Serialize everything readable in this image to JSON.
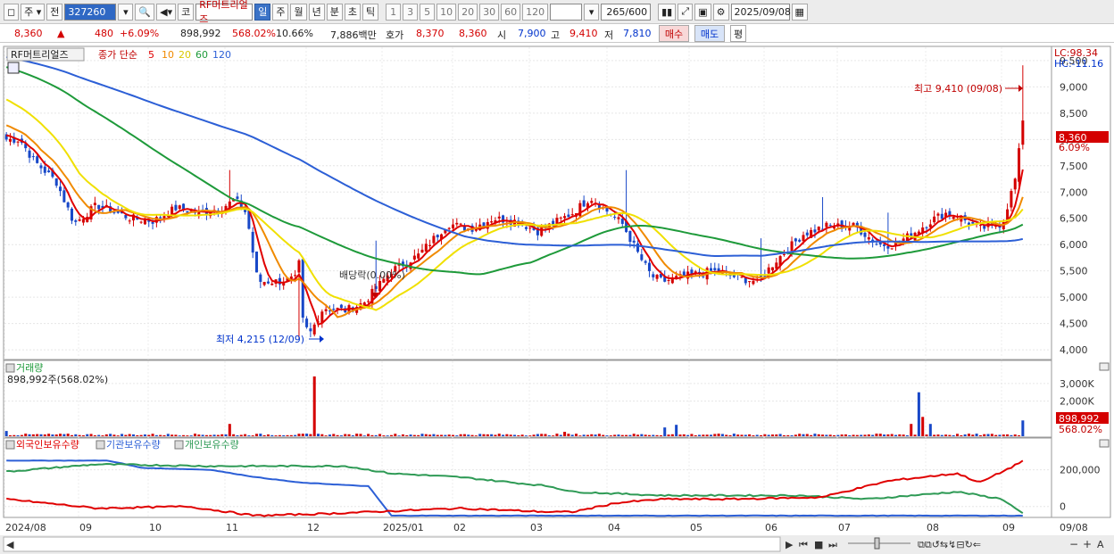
{
  "toolbar": {
    "type_label": "주",
    "market_label": "전",
    "code": "327260",
    "corp_btn": "코",
    "stock_name": "RF머트리얼즈",
    "periods": [
      "일",
      "주",
      "월",
      "년",
      "분",
      "초",
      "틱"
    ],
    "selected_period": "일",
    "nums": [
      "1",
      "3",
      "5",
      "10",
      "20",
      "30",
      "60",
      "120"
    ],
    "count": "265/600",
    "date": "2025/09/08"
  },
  "quote": {
    "price": "8,360",
    "up_arrow": "▲",
    "change": "480",
    "change_pct": "+6.09%",
    "volume": "898,992",
    "volume_pct": "568.02%",
    "turnover": "10.66%",
    "amount": "7,886백만",
    "ask_label": "호가",
    "ask": "8,370",
    "bid": "8,360",
    "open_label": "시",
    "open": "7,900",
    "high_label": "고",
    "high": "9,410",
    "low_label": "저",
    "low": "7,810",
    "buy_btn": "매수",
    "sell_btn": "매도",
    "eval_btn": "평"
  },
  "price_panel": {
    "name": "RF머트리얼즈",
    "ma_label": "종가 단순",
    "ma_periods": [
      "5",
      "10",
      "20",
      "60",
      "120"
    ],
    "ma_colors": [
      "#e00000",
      "#f08a00",
      "#f0e000",
      "#1e9a3a",
      "#2c5fd6"
    ],
    "lc": "LC:98.34",
    "hc": "HC:-11.16",
    "high_annot": "최고 9,410 (09/08)",
    "low_annot": "최저 4,215 (12/09)",
    "div_annot": "배당락(0.00%)",
    "last_price": "8,360",
    "last_pct": "6.09%"
  },
  "volume_panel": {
    "title": "거래량",
    "value": "898,992주(568.02%)",
    "last_value": "898,992",
    "last_pct": "568.02%"
  },
  "holding_panel": {
    "legend": [
      "외국인보유수량",
      "기관보유수량",
      "개인보유수량"
    ],
    "colors": [
      "#e00000",
      "#2c5fd6",
      "#2e9a55"
    ]
  },
  "axis": {
    "x_labels": [
      "2024/08",
      "09",
      "10",
      "11",
      "12",
      "2025/01",
      "02",
      "03",
      "04",
      "05",
      "06",
      "07",
      "08",
      "09"
    ],
    "x_right": "09/08"
  },
  "chart_data": [
    {
      "type": "line",
      "title": "RF머트리얼즈 일봉 (종가 단순 이동평균 5/10/20/60/120)",
      "ylim": [
        3900,
        9600
      ],
      "y_ticks": [
        4000,
        4500,
        5000,
        5500,
        6000,
        6500,
        7000,
        7500,
        8000,
        8500,
        9000,
        9500
      ],
      "x": [
        "2024/08",
        "09",
        "10",
        "11",
        "12",
        "2025/01",
        "02",
        "03",
        "04",
        "05",
        "06",
        "07",
        "08",
        "09"
      ],
      "series": [
        {
          "name": "종가",
          "values": [
            8000,
            7400,
            6350,
            6700,
            6550,
            5300,
            4700,
            4950,
            6200,
            5950,
            6500,
            5600,
            5600,
            6300,
            6100,
            6400,
            8360
          ]
        },
        {
          "name": "120",
          "values": [
            9400,
            9200,
            8700,
            8100,
            7400,
            6900,
            6450,
            6150,
            5900,
            5850,
            5780,
            5720,
            5700,
            5760,
            5800,
            5870,
            5960
          ]
        }
      ],
      "high": {
        "value": 9410,
        "date": "09/08"
      },
      "low": {
        "value": 4215,
        "date": "12/09"
      }
    },
    {
      "type": "bar",
      "title": "거래량",
      "ylim": [
        0,
        3500000
      ],
      "y_ticks": [
        "2,000K",
        "3,000K"
      ],
      "last": 898992
    },
    {
      "type": "line",
      "title": "보유수량",
      "ylim": [
        -50000,
        300000
      ],
      "y_ticks": [
        "0",
        "200,000"
      ]
    }
  ]
}
